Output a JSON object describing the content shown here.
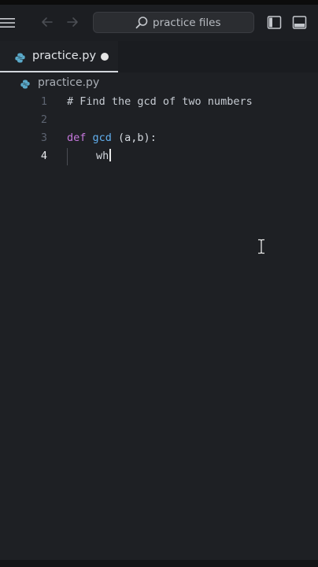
{
  "titlebar": {
    "menu_icon": "hamburger-menu-icon",
    "back_icon": "arrow-left-icon",
    "forward_icon": "arrow-right-icon",
    "search_label": "practice files",
    "search_icon": "search-icon",
    "layout_icons": [
      "split-editor-icon",
      "toggle-panel-icon"
    ]
  },
  "tab": {
    "label": "practice.py",
    "icon": "python-file-icon",
    "modified_indicator": "unsaved-dot-icon"
  },
  "breadcrumb": {
    "label": "practice.py",
    "icon": "python-file-icon"
  },
  "editor": {
    "active_line": 4,
    "lines": [
      {
        "number": "1",
        "comment": "# Find the gcd of two numbers"
      },
      {
        "number": "2"
      },
      {
        "number": "3",
        "keyword": "def",
        "function": "gcd",
        "rest": " (a,b):"
      },
      {
        "number": "4",
        "typed": "wh"
      }
    ]
  },
  "colors": {
    "background": "#1e2024",
    "keyword": "#c678dd",
    "function": "#61afef",
    "comment": "#c7ccd3",
    "line_number": "#5c6370",
    "line_number_active": "#e8eaed"
  }
}
